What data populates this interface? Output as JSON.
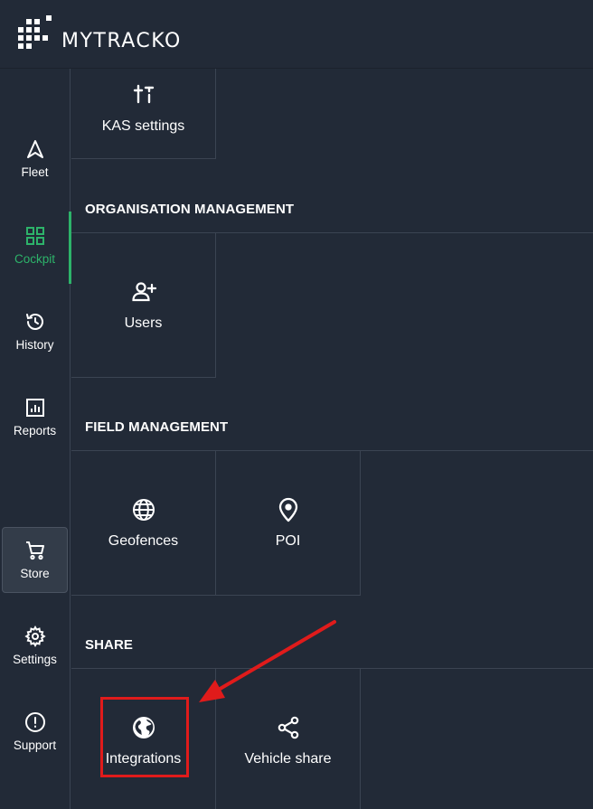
{
  "header": {
    "brand": "MYTRACKO"
  },
  "sidebar": {
    "items": [
      {
        "key": "fleet",
        "label": "Fleet",
        "icon": "navigation-arrow-icon"
      },
      {
        "key": "cockpit",
        "label": "Cockpit",
        "icon": "grid-icon",
        "active": true
      },
      {
        "key": "history",
        "label": "History",
        "icon": "history-icon"
      },
      {
        "key": "reports",
        "label": "Reports",
        "icon": "chart-icon"
      },
      {
        "key": "store",
        "label": "Store",
        "icon": "cart-icon"
      },
      {
        "key": "settings",
        "label": "Settings",
        "icon": "gear-icon"
      },
      {
        "key": "support",
        "label": "Support",
        "icon": "alert-circle-icon"
      }
    ]
  },
  "main": {
    "top_tile": {
      "label": "KAS settings",
      "icon": "sliders-icon"
    },
    "sections": [
      {
        "title": "ORGANISATION MANAGEMENT",
        "tiles": [
          {
            "label": "Users",
            "icon": "add-user-icon"
          }
        ]
      },
      {
        "title": "FIELD MANAGEMENT",
        "tiles": [
          {
            "label": "Geofences",
            "icon": "globe-icon"
          },
          {
            "label": "POI",
            "icon": "map-pin-icon"
          }
        ]
      },
      {
        "title": "SHARE",
        "tiles": [
          {
            "label": "Integrations",
            "icon": "earth-icon"
          },
          {
            "label": "Vehicle share",
            "icon": "share-icon"
          }
        ]
      }
    ]
  },
  "colors": {
    "background": "#222a37",
    "accent": "#2db36a",
    "highlight": "#e01b1b",
    "border": "#3b4452"
  }
}
